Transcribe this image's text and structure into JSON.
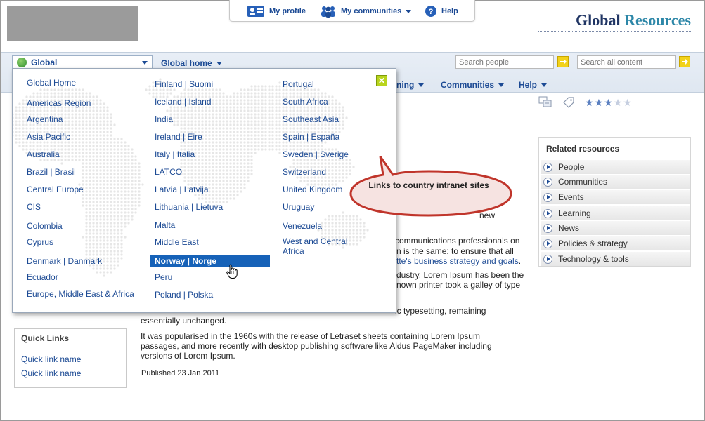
{
  "header": {
    "brand_part1": "Global",
    "brand_part2": "Resources",
    "brand_colors": {
      "primary": "#1f3463",
      "accent": "#2d87a8"
    },
    "util_links": [
      {
        "label": "My profile",
        "icon": "profile-card-icon"
      },
      {
        "label": "My communities",
        "icon": "people-group-icon",
        "has_menu": true
      },
      {
        "label": "Help",
        "icon": "help-circle-icon"
      }
    ]
  },
  "nav": {
    "global_selector": "Global",
    "global_home": "Global home",
    "search_people_placeholder": "Search people",
    "search_all_placeholder": "Search all content",
    "secondary": [
      {
        "label": "ning",
        "has_menu": true
      },
      {
        "label": "Communities",
        "has_menu": true
      },
      {
        "label": "Help",
        "has_menu": true
      }
    ]
  },
  "rating": {
    "value": 3,
    "max": 5
  },
  "dropdown": {
    "col1": [
      "Global Home",
      "Americas Region",
      "Argentina",
      "Asia Pacific",
      "Australia",
      "Brazil | Brasil",
      "Central Europe",
      "CIS",
      "Colombia",
      "Cyprus",
      "Denmark | Danmark",
      "Ecuador",
      "Europe, Middle East & Africa"
    ],
    "col2": [
      "Finland | Suomi",
      "Iceland | Island",
      "India",
      "Ireland | Eire",
      "Italy | Italia",
      "LATCO",
      "Latvia | Latvija",
      "Lithuania | Lietuva",
      "Malta",
      "Middle East",
      "Norway | Norge",
      "Peru",
      "Poland | Polska"
    ],
    "col3": [
      "Portugal",
      "South Africa",
      "Southeast Asia",
      "Spain | España",
      "Sweden | Sverige",
      "Switzerland",
      "United Kingdom",
      "Uruguay",
      "Venezuela",
      "West and Central Africa"
    ],
    "active_item": "Norway | Norge",
    "close_label": "✕"
  },
  "callout": {
    "text": "Links to country intranet sites",
    "color": "#c0352b"
  },
  "content": {
    "frag_new": "new",
    "frag_comm": "communications professionals on",
    "frag_same": "n is the same: to ensure that all",
    "frag_link": "tte's business strategy and goals",
    "frag_dot": ".",
    "frag_industry": "dustry. Lorem Ipsum has been the",
    "frag_printer": "nown printer took a galley of type",
    "frag_typesetting": "ic typesetting, remaining",
    "frag_unchanged": "essentially unchanged.",
    "para2_l1": "It was popularised in the 1960s with the release of Letraset sheets containing Lorem Ipsum",
    "para2_l2": "passages, and more recently with desktop publishing software like Aldus PageMaker including",
    "para2_l3": "versions of Lorem Ipsum.",
    "published": "Published 23 Jan 2011"
  },
  "related": {
    "title": "Related resources",
    "items": [
      "People",
      "Communities",
      "Events",
      "Learning",
      "News",
      "Policies & strategy",
      "Technology & tools"
    ]
  },
  "quick_links": {
    "title": "Quick Links",
    "items": [
      "Quick link name",
      "Quick link name"
    ]
  }
}
